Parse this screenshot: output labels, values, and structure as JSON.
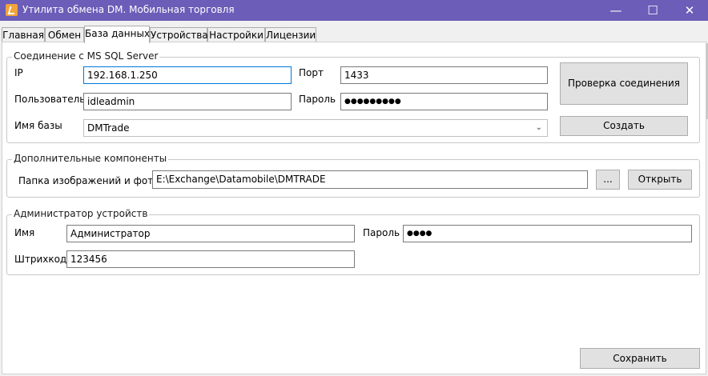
{
  "window": {
    "title": "Утилита обмена DM. Мобильная торговля",
    "minimize": "—",
    "maximize": "☐",
    "close": "✕"
  },
  "tabs": [
    {
      "label": "Главная"
    },
    {
      "label": "Обмен"
    },
    {
      "label": "База данных",
      "active": true
    },
    {
      "label": "Устройства"
    },
    {
      "label": "Настройки"
    },
    {
      "label": "Лицензии"
    }
  ],
  "connection": {
    "group_title": "Соединение с MS SQL Server",
    "ip_label": "IP",
    "ip_value": "192.168.1.250",
    "port_label": "Порт",
    "port_value": "1433",
    "user_label": "Пользователь",
    "user_value": "idleadmin",
    "password_label": "Пароль",
    "password_value": "●●●●●●●●●",
    "db_label": "Имя базы",
    "db_value": "DMTrade",
    "check_button": "Проверка соединения",
    "create_button": "Создать"
  },
  "components": {
    "group_title": "Дополнительные компоненты",
    "folder_label": "Папка изображений и фото",
    "folder_value": "E:\\Exchange\\Datamobile\\DMTRADE",
    "browse_button": "...",
    "open_button": "Открыть"
  },
  "admin": {
    "group_title": "Администратор устройств",
    "name_label": "Имя",
    "name_value": "Администратор",
    "password_label": "Пароль",
    "password_value": "●●●●",
    "barcode_label": "Штрихкод",
    "barcode_value": "123456"
  },
  "footer": {
    "save_button": "Сохранить"
  }
}
